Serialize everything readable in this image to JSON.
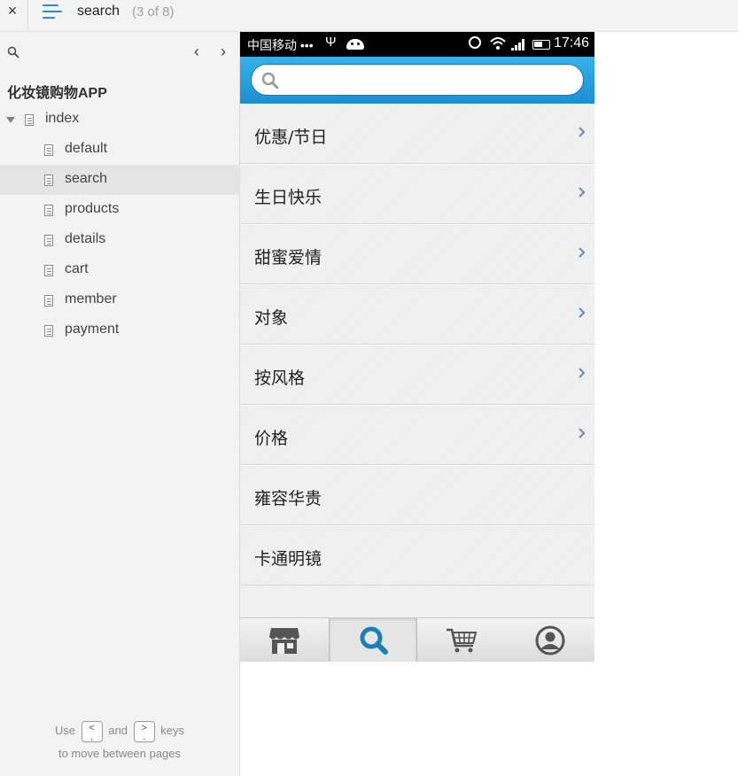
{
  "topbar": {
    "close_label": "×",
    "page_name": "search",
    "page_count": "(3 of 8)"
  },
  "sidebar": {
    "project_title": "化妆镜购物APP",
    "prev_label": "‹",
    "next_label": "›",
    "root": {
      "label": "index",
      "expanded": true
    },
    "pages": [
      {
        "label": "default",
        "selected": false
      },
      {
        "label": "search",
        "selected": true
      },
      {
        "label": "products",
        "selected": false
      },
      {
        "label": "details",
        "selected": false
      },
      {
        "label": "cart",
        "selected": false
      },
      {
        "label": "member",
        "selected": false
      },
      {
        "label": "payment",
        "selected": false
      }
    ],
    "hint": {
      "use": "Use",
      "key_prev": "<",
      "key_prev_alt": ",",
      "and": "and",
      "key_next": ">",
      "key_next_alt": ".",
      "keys": "keys",
      "line2": "to move between pages"
    }
  },
  "phone": {
    "statusbar": {
      "carrier": "中国移动 •••",
      "usb": "Ψ",
      "time": "17:46"
    },
    "search": {
      "placeholder": "",
      "value": ""
    },
    "categories": [
      {
        "label": "优惠/节日",
        "has_arrow": true
      },
      {
        "label": "生日快乐",
        "has_arrow": true
      },
      {
        "label": "甜蜜爱情",
        "has_arrow": true
      },
      {
        "label": "对象",
        "has_arrow": true
      },
      {
        "label": "按风格",
        "has_arrow": true
      },
      {
        "label": "价格",
        "has_arrow": true
      },
      {
        "label": "雍容华贵",
        "has_arrow": false
      },
      {
        "label": "卡通明镜",
        "has_arrow": false
      }
    ],
    "tabs": [
      {
        "icon": "store-icon",
        "active": false
      },
      {
        "icon": "search-icon",
        "active": true
      },
      {
        "icon": "cart-icon",
        "active": false
      },
      {
        "icon": "user-icon",
        "active": false
      }
    ]
  },
  "colors": {
    "accent_blue": "#2a8ae0",
    "header_blue": "#1b8fd2",
    "tab_active_icon": "#1b7fb8",
    "tab_icon": "#555555"
  }
}
